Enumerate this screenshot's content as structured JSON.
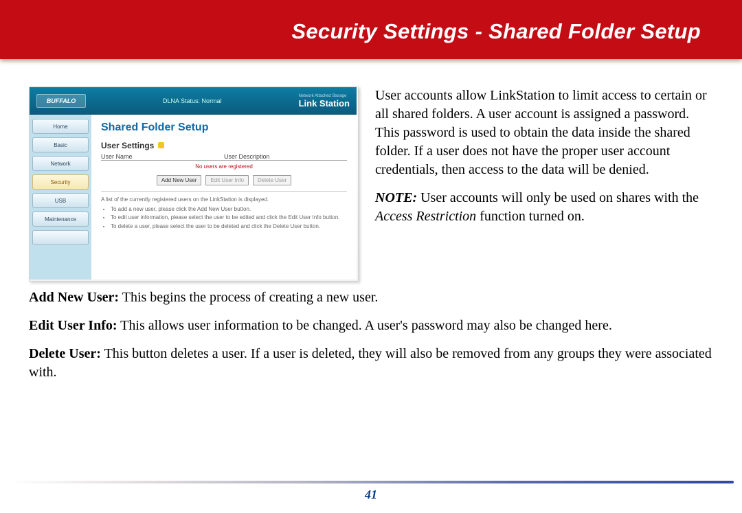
{
  "header": {
    "title": "Security Settings - Shared Folder Setup"
  },
  "screenshot": {
    "brand": "BUFFALO",
    "status": "DLNA Status: Normal",
    "product_small": "Network Attached Storage",
    "product": "Link Station",
    "nav": {
      "items": [
        {
          "label": "Home"
        },
        {
          "label": "Basic"
        },
        {
          "label": "Network"
        },
        {
          "label": "Security"
        },
        {
          "label": "USB"
        },
        {
          "label": "Maintenance"
        },
        {
          "label": ""
        }
      ],
      "selected_index": 3
    },
    "main": {
      "title": "Shared Folder Setup",
      "subtitle": "User Settings",
      "columns": {
        "c1": "User Name",
        "c2": "User Description"
      },
      "empty_msg": "No users are registered",
      "buttons": {
        "add": "Add New User",
        "edit": "Edit User Info",
        "delete": "Delete User"
      },
      "hint_intro": "A list of the currently registered users on the LinkStation is displayed.",
      "hint_items": [
        "To add a new user, please click the Add New User button.",
        "To edit user information, please select the user to be edited and click the Edit User Info button.",
        "To delete a user, please select the user to be deleted and click the Delete User button."
      ]
    }
  },
  "paragraphs": {
    "intro": "User accounts allow LinkStation to limit access to certain or all shared folders.  A user account is assigned a password.  This password is used to obtain the data inside the shared folder.  If a user does not have the proper user account credentials, then access to the data will be denied.",
    "note_lead": "NOTE:",
    "note_body_a": "  User accounts will only be used on shares with the ",
    "note_func": "Access Restriction",
    "note_body_b": " function turned on.",
    "add_label": "Add New User:",
    "add_body": "  This begins the process of creating a new user.",
    "edit_label": "Edit User Info:",
    "edit_body": "  This allows user information to be changed.  A user's password may also be changed here.",
    "delete_label": "Delete User:",
    "delete_body": "  This button deletes a user.  If a user is deleted, they will also be removed from any groups they were associated with."
  },
  "footer": {
    "page_number": "41"
  }
}
